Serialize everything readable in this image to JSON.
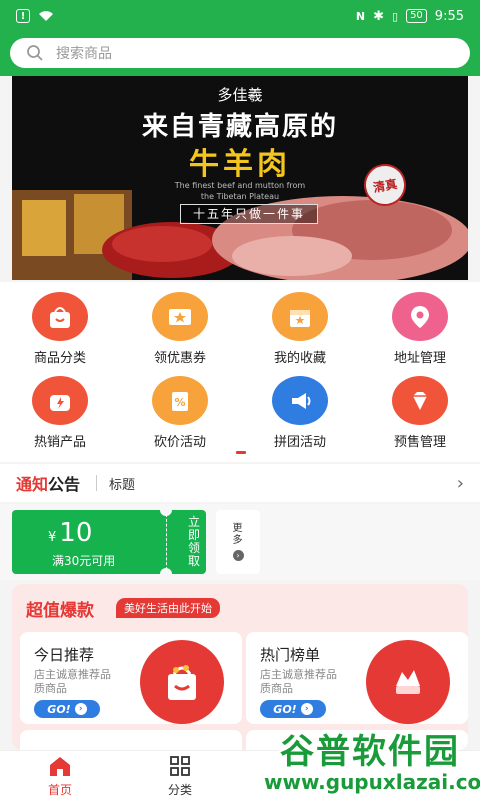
{
  "status_bar": {
    "time": "9:55",
    "battery": "50",
    "notification_badge": "!"
  },
  "search": {
    "placeholder": "搜索商品"
  },
  "banner": {
    "brand": "多佳羲",
    "headline": "来自青藏高原的",
    "product": "牛羊肉",
    "subtitle_en_1": "The finest beef and mutton from",
    "subtitle_en_2": "the Tibetan Plateau",
    "tagline": "十五年只做一件事",
    "stamp": "清真"
  },
  "grid": {
    "items": [
      {
        "label": "商品分类",
        "icon": "shopping-bag-icon",
        "color": "#f0553a"
      },
      {
        "label": "领优惠券",
        "icon": "coupon-star-icon",
        "color": "#f7a23b"
      },
      {
        "label": "我的收藏",
        "icon": "favorite-box-icon",
        "color": "#f7a23b"
      },
      {
        "label": "地址管理",
        "icon": "location-pin-icon",
        "color": "#f0628e"
      },
      {
        "label": "热销产品",
        "icon": "hot-sale-icon",
        "color": "#f0553a"
      },
      {
        "label": "砍价活动",
        "icon": "bargain-tag-icon",
        "color": "#f7a23b"
      },
      {
        "label": "拼团活动",
        "icon": "megaphone-icon",
        "color": "#2f7de1"
      },
      {
        "label": "预售管理",
        "icon": "diamond-icon",
        "color": "#f0553a"
      }
    ]
  },
  "notice": {
    "label_red": "通知",
    "label_black": "公告",
    "text": "标题"
  },
  "coupon": {
    "currency": "¥",
    "amount": "10",
    "condition": "满30元可用",
    "claim_label": "立即领取",
    "more_label": "更多"
  },
  "promo": {
    "title": "超值爆款",
    "badge": "美好生活由此开始",
    "cards": [
      {
        "title": "今日推荐",
        "desc": "店主诚意推荐品质商品",
        "go": "GO!"
      },
      {
        "title": "热门榜单",
        "desc": "店主诚意推荐品质商品",
        "go": "GO!"
      }
    ]
  },
  "bottom_nav": {
    "items": [
      {
        "label": "首页",
        "icon": "home-icon",
        "active": true
      },
      {
        "label": "分类",
        "icon": "grid-category-icon",
        "active": false
      }
    ]
  },
  "watermark": {
    "main": "谷普软件园",
    "url": "www.gupuxlazai.com"
  },
  "colors": {
    "brand_green": "#22b14c",
    "accent_red": "#e53935",
    "coupon_green": "#15b24d",
    "go_blue": "#2f7de1"
  }
}
